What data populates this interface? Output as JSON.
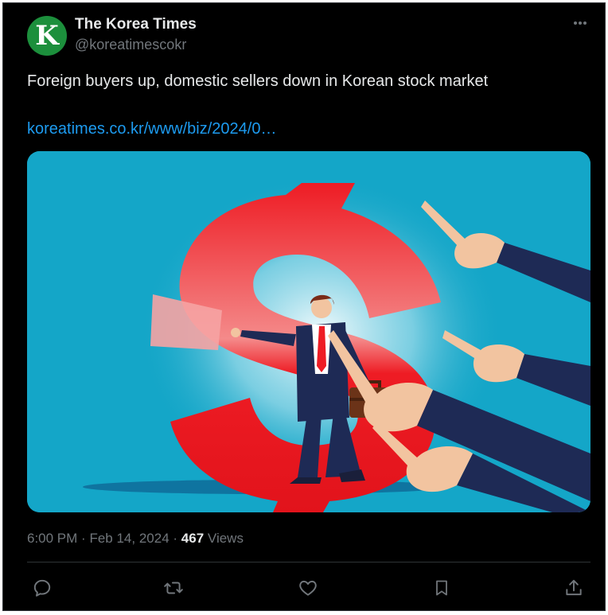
{
  "tweet": {
    "author": {
      "display_name": "The Korea Times",
      "handle": "@koreatimescokr",
      "avatar_letter": "K",
      "avatar_color": "#1c8f3c"
    },
    "text": "Foreign buyers up, domestic sellers down in Korean stock market",
    "link": "koreatimes.co.kr/www/biz/2024/0…",
    "media": {
      "description_icon": "illustration-dollar-sign-pointing-hands"
    },
    "meta": {
      "time": "6:00 PM",
      "separator": "·",
      "date": "Feb 14, 2024",
      "views_count": "467",
      "views_label": "Views"
    },
    "actions": [
      {
        "name": "reply-icon"
      },
      {
        "name": "repost-icon"
      },
      {
        "name": "like-icon"
      },
      {
        "name": "bookmark-icon"
      },
      {
        "name": "share-icon"
      }
    ]
  },
  "colors": {
    "background": "#000000",
    "text": "#e7e9ea",
    "secondary": "#71767b",
    "link": "#1d9bf0",
    "media_bg": "#14a6c8",
    "dollar_red": "#ee1c24"
  }
}
